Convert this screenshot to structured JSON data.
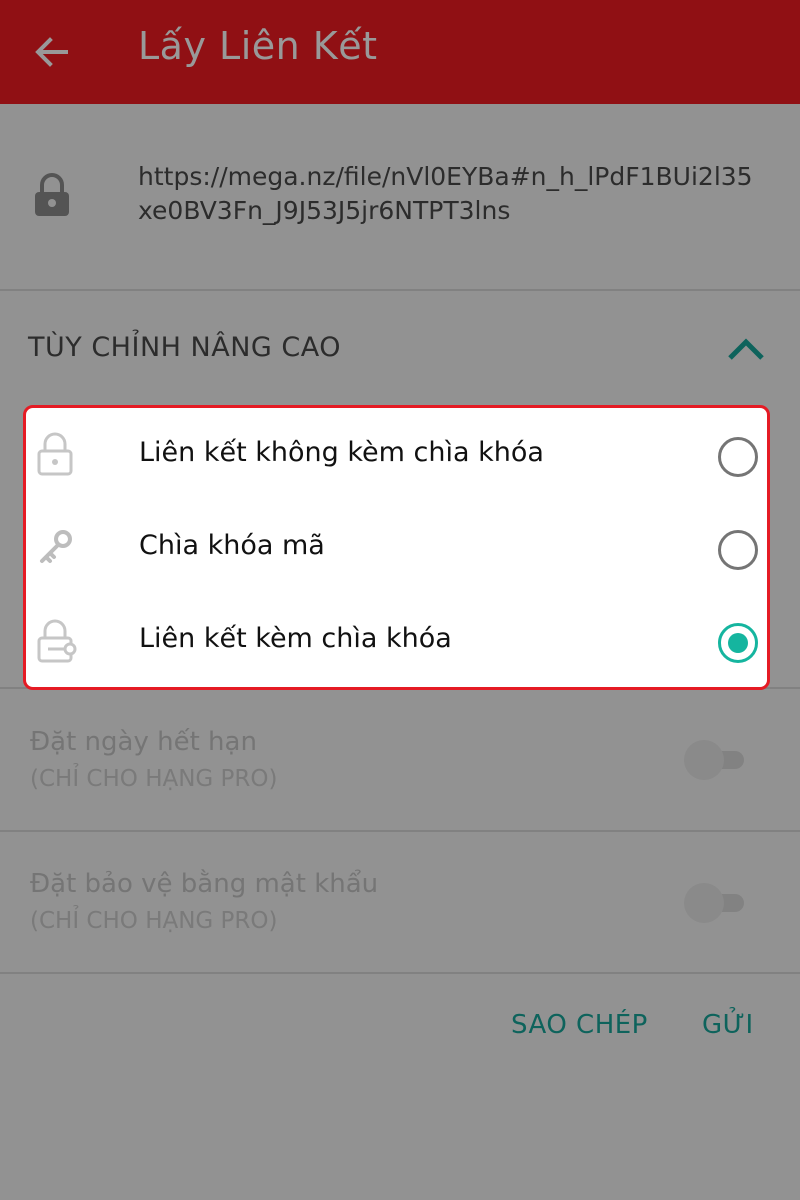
{
  "app_bar": {
    "title": "Lấy Liên Kết",
    "back_icon": "arrow-left-icon",
    "color": "#f01b22"
  },
  "link": {
    "url": "https://mega.nz/file/nVl0EYBa#n_h_lPdF1BUi2l35xe0BV3Fn_J9J53J5jr6NTPT3lns",
    "icon": "lock-icon"
  },
  "advanced": {
    "header": "TÙY CHỈNH NÂNG CAO",
    "expanded": true,
    "options": [
      {
        "label": "Liên kết không kèm chìa khóa",
        "icon": "lock-icon",
        "selected": false
      },
      {
        "label": "Chìa khóa mã",
        "icon": "key-icon",
        "selected": false
      },
      {
        "label": "Liên kết kèm chìa khóa",
        "icon": "lock-key-icon",
        "selected": true
      }
    ]
  },
  "settings": [
    {
      "title": "Đặt ngày hết hạn",
      "subtitle": "(CHỈ CHO HẠNG PRO)",
      "enabled": false
    },
    {
      "title": "Đặt bảo vệ bằng mật khẩu",
      "subtitle": "(CHỈ CHO HẠNG PRO)",
      "enabled": false
    }
  ],
  "footer": {
    "copy_label": "SAO CHÉP",
    "send_label": "GỬI"
  },
  "colors": {
    "accent": "#15b59f",
    "highlight_border": "#e51b24"
  }
}
